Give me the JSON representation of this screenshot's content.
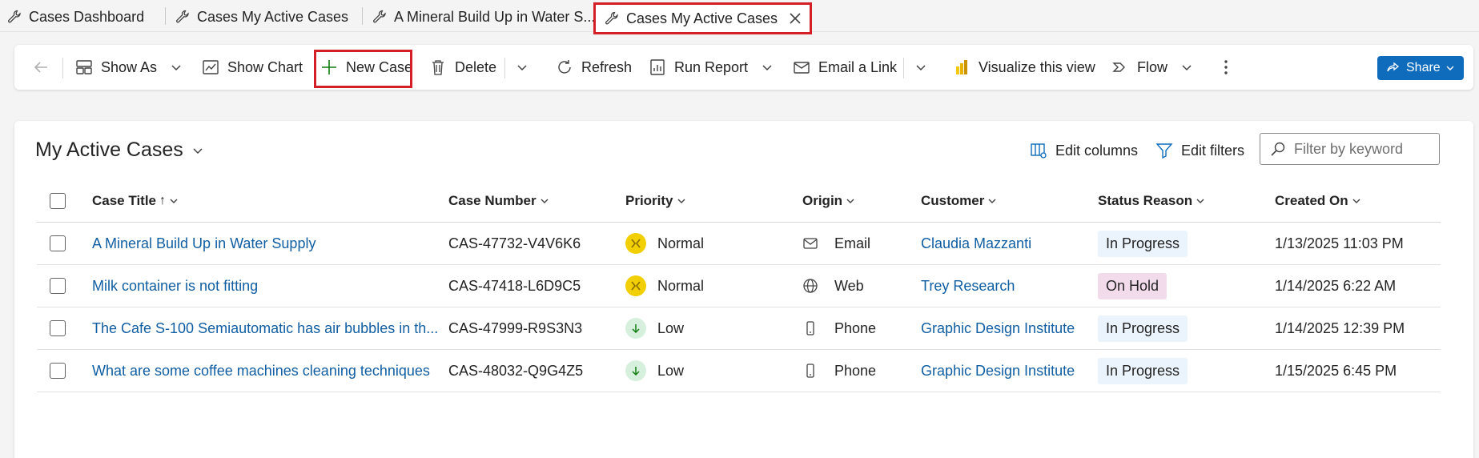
{
  "tabs": [
    {
      "label": "Cases Dashboard",
      "active": false
    },
    {
      "label": "Cases My Active Cases",
      "active": false
    },
    {
      "label": "A Mineral Build Up in Water S...",
      "active": false
    },
    {
      "label": "Cases My Active Cases",
      "active": true
    }
  ],
  "toolbar": {
    "show_as": "Show As",
    "show_chart": "Show Chart",
    "new_case": "New Case",
    "delete": "Delete",
    "refresh": "Refresh",
    "run_report": "Run Report",
    "email_link": "Email a Link",
    "visualize": "Visualize this view",
    "flow": "Flow",
    "share": "Share"
  },
  "view": {
    "title": "My Active Cases",
    "edit_columns": "Edit columns",
    "edit_filters": "Edit filters",
    "filter_placeholder": "Filter by keyword"
  },
  "columns": {
    "case_title": "Case Title",
    "case_title_sort": "↑",
    "case_number": "Case Number",
    "priority": "Priority",
    "origin": "Origin",
    "customer": "Customer",
    "status_reason": "Status Reason",
    "created_on": "Created On"
  },
  "rows": [
    {
      "title": "A Mineral Build Up in Water Supply",
      "number": "CAS-47732-V4V6K6",
      "priority": "Normal",
      "priority_icon": "normal-priority-icon",
      "origin": "Email",
      "origin_icon": "email-icon",
      "customer": "Claudia Mazzanti",
      "status": "In Progress",
      "status_color": "#ebf3fc",
      "created": "1/13/2025 11:03 PM"
    },
    {
      "title": "Milk container is not fitting",
      "number": "CAS-47418-L6D9C5",
      "priority": "Normal",
      "priority_icon": "normal-priority-icon",
      "origin": "Web",
      "origin_icon": "globe-icon",
      "customer": "Trey Research",
      "status": "On Hold",
      "status_color": "#f2dcec",
      "created": "1/14/2025 6:22 AM"
    },
    {
      "title": "The Cafe S-100 Semiautomatic has air bubbles in th...",
      "number": "CAS-47999-R9S3N3",
      "priority": "Low",
      "priority_icon": "low-priority-icon",
      "origin": "Phone",
      "origin_icon": "phone-icon",
      "customer": "Graphic Design Institute",
      "status": "In Progress",
      "status_color": "#ebf3fc",
      "created": "1/14/2025 12:39 PM"
    },
    {
      "title": "What are some coffee machines cleaning techniques",
      "number": "CAS-48032-Q9G4Z5",
      "priority": "Low",
      "priority_icon": "low-priority-icon",
      "origin": "Phone",
      "origin_icon": "phone-icon",
      "customer": "Graphic Design Institute",
      "status": "In Progress",
      "status_color": "#ebf3fc",
      "created": "1/15/2025 6:45 PM"
    }
  ],
  "colors": {
    "accent": "#0f6cbd",
    "link": "#115ea3",
    "highlight_box": "#d51f26",
    "normal_priority": "#f2cf00",
    "low_priority": "#d6f0dd"
  }
}
